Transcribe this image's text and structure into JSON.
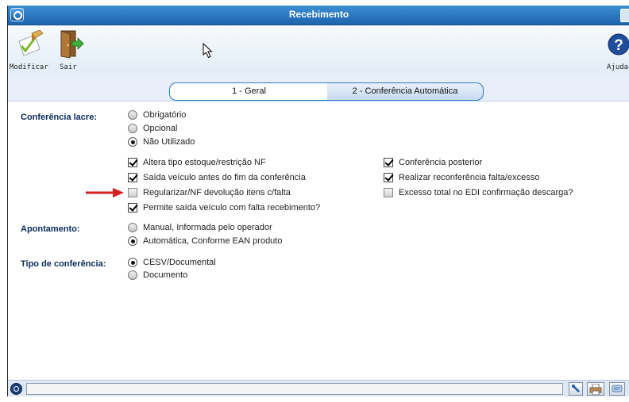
{
  "window": {
    "title": "Recebimento"
  },
  "toolbar": {
    "modify_label": "Modificar",
    "exit_label": "Sair",
    "help_label": "Ajuda"
  },
  "tabs": [
    {
      "label": "1 - Geral",
      "active": true
    },
    {
      "label": "2 - Conferência Automática",
      "active": false
    }
  ],
  "conferencia_lacre": {
    "label": "Conferência lacre:",
    "options": [
      "Obrigatório",
      "Opcional",
      "Não Utilizado"
    ],
    "selected": "Não Utilizado"
  },
  "checkboxes_left": [
    {
      "label": "Altera tipo estoque/restrição NF",
      "checked": true
    },
    {
      "label": "Saída veículo antes do fim da conferência",
      "checked": true
    },
    {
      "label": "Regularizar/NF devolução itens c/falta",
      "checked": false
    },
    {
      "label": "Permite saída veículo com falta recebimento?",
      "checked": true
    }
  ],
  "checkboxes_right": [
    {
      "label": "Conferência posterior",
      "checked": true
    },
    {
      "label": "Realizar reconferência falta/excesso",
      "checked": true
    },
    {
      "label": "Excesso total no EDI confirmação descarga?",
      "checked": false
    }
  ],
  "apontamento": {
    "label": "Apontamento:",
    "options": [
      "Manual, Informada pelo operador",
      "Automática, Conforme EAN produto"
    ],
    "selected": "Automática, Conforme EAN produto"
  },
  "tipo_conferencia": {
    "label": "Tipo de conferência:",
    "options": [
      "CESV/Documental",
      "Documento"
    ],
    "selected": "CESV/Documental"
  },
  "colors": {
    "title_bar": "#1d63ad",
    "tab_border": "#2a7ac8",
    "section_label": "#0c2a5c",
    "arrow": "#d42020"
  },
  "icons": [
    "app-icon",
    "modify-icon",
    "exit-door-icon",
    "help-icon",
    "cursor-icon",
    "red-arrow-icon",
    "status-icon",
    "tool-icon",
    "print-icon",
    "chat-icon"
  ]
}
